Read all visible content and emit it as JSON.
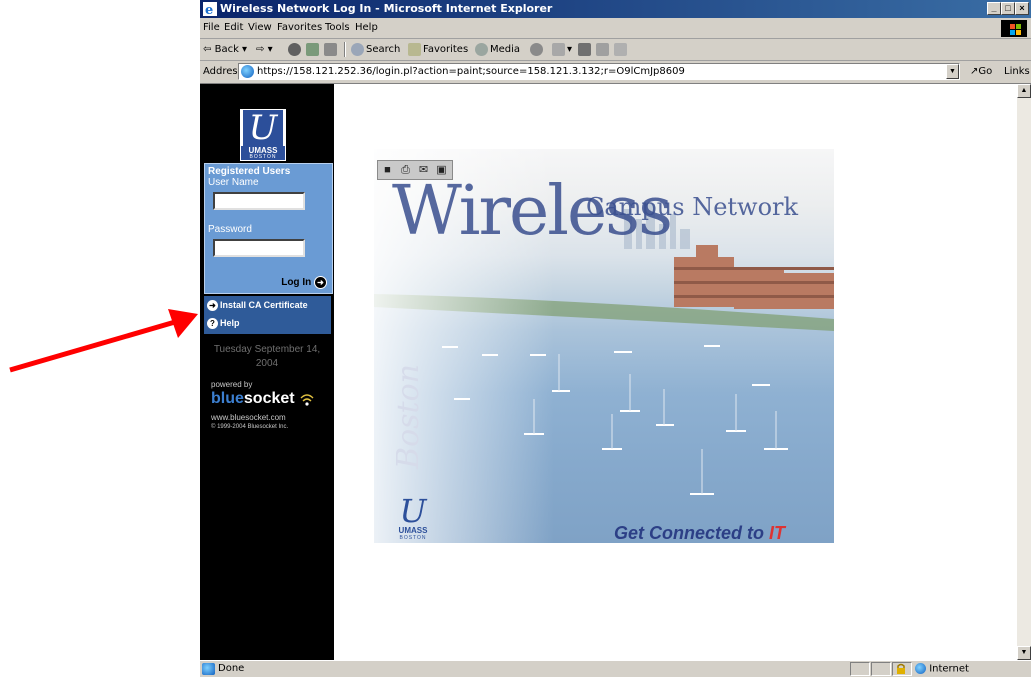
{
  "window": {
    "title": "Wireless Network Log In - Microsoft Internet Explorer",
    "buttons": [
      "_",
      "□",
      "×"
    ]
  },
  "menu": [
    "File",
    "Edit",
    "View",
    "Favorites",
    "Tools",
    "Help"
  ],
  "toolbar": {
    "back": "Back",
    "search": "Search",
    "favorites": "Favorites",
    "media": "Media"
  },
  "address": {
    "label": "Address",
    "url": "https://158.121.252.36/login.pl?action=paint;source=158.121.3.132;r=O9lCmJp8609",
    "go": "Go",
    "links": "Links"
  },
  "sidebar": {
    "logo_text": "UMASS",
    "logo_sub": "BOSTON",
    "registered_title": "Registered Users",
    "username_label": "User Name",
    "username_value": "",
    "password_label": "Password",
    "password_value": "",
    "login_label": "Log In",
    "install_ca": "Install CA Certificate",
    "help": "Help",
    "date": "Tuesday September 14, 2004",
    "powered_by": "powered by",
    "brand_blue": "blue",
    "brand_white": "socket",
    "brand_url": "www.bluesocket.com",
    "brand_copyright": "© 1999-2004 Bluesocket Inc."
  },
  "banner": {
    "title_big": "Wireless",
    "title_small": "Campus Network",
    "side_text": "Boston",
    "logo_text": "UMASS",
    "logo_sub": "BOSTON",
    "tagline": "Get Connected to",
    "tagline_highlight": "IT"
  },
  "status": {
    "text": "Done",
    "zone": "Internet"
  },
  "colors": {
    "annotation_arrow": "#ff0000",
    "title_bar": "#0a246a",
    "login_box": "#6a9bd4",
    "links_box": "#2f5b99"
  }
}
